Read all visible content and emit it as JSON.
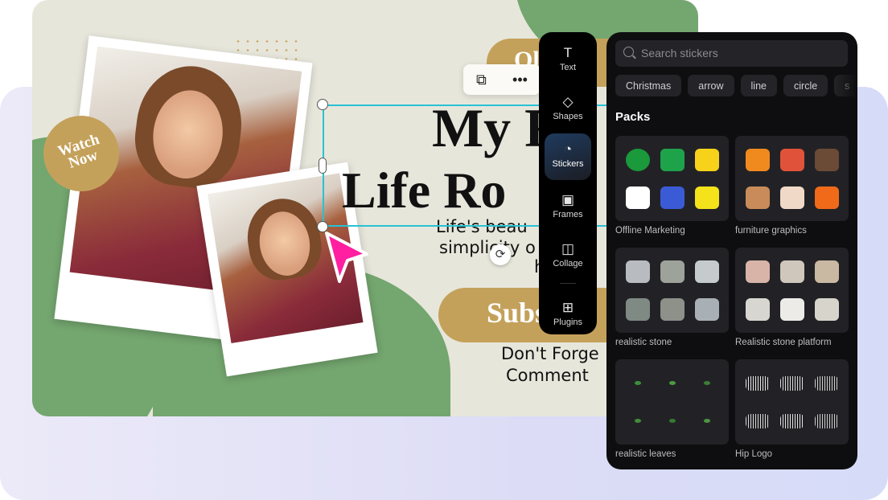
{
  "canvas": {
    "badge": "Watch Now",
    "top_pill": "Ol",
    "title_line1": "My F",
    "title_line2": "Life Ro",
    "subtitle_line1": "Life's beau",
    "subtitle_line2": "simplicity o",
    "subtitle_line3": "h",
    "cta": "Subs",
    "footer_line1": "Don't Forge",
    "footer_line2": "Comment",
    "accent": "#c4a15a",
    "green": "#74a66f",
    "selection_color": "#28c2d4",
    "cursor_color": "#ff1fa0"
  },
  "mini_toolbar": {
    "duplicate_icon": "duplicate-icon",
    "more_icon": "more-icon"
  },
  "toolbar": {
    "items": [
      {
        "label": "Text",
        "icon": "T"
      },
      {
        "label": "Shapes",
        "icon": "◇"
      },
      {
        "label": "Stickers",
        "icon": "◔",
        "active": true
      },
      {
        "label": "Frames",
        "icon": "▣"
      },
      {
        "label": "Collage",
        "icon": "◫"
      },
      {
        "label": "Plugins",
        "icon": "⊞"
      }
    ]
  },
  "panel": {
    "search_placeholder": "Search stickers",
    "chips": [
      "Christmas",
      "arrow",
      "line",
      "circle",
      "s"
    ],
    "section_title": "Packs",
    "packs": [
      {
        "label": "Offline Marketing",
        "colors": [
          "#1a9a3a",
          "#1fa34a",
          "#f6d21a",
          "#ffffff",
          "#3b5bd6",
          "#f4e21a"
        ]
      },
      {
        "label": "furniture graphics",
        "colors": [
          "#f08a1e",
          "#e0533a",
          "#6b4a36",
          "#c98b5a",
          "#f1d9c8",
          "#f06a1a"
        ]
      },
      {
        "label": "realistic stone",
        "colors": [
          "#b8bcc0",
          "#9da39a",
          "#c5cacd",
          "#7f8a84",
          "#8e908a",
          "#a9b0b5"
        ]
      },
      {
        "label": "Realistic stone platform",
        "colors": [
          "#d8b4a8",
          "#cfc7bc",
          "#c9b9a2",
          "#d8d6d0",
          "#ecebe8",
          "#d7d4cc"
        ]
      },
      {
        "label": "realistic leaves",
        "colors": [
          "#3f8f3a",
          "#4e9a3f",
          "#3a7f34",
          "#428c3a",
          "#367a30",
          "#4b9541"
        ]
      },
      {
        "label": "Hip Logo",
        "colors": [
          "#e6e6e6",
          "#dcdcdc",
          "#cfcfcf",
          "#d8d8d8",
          "#e2e2e2",
          "#cccccc"
        ]
      }
    ]
  }
}
